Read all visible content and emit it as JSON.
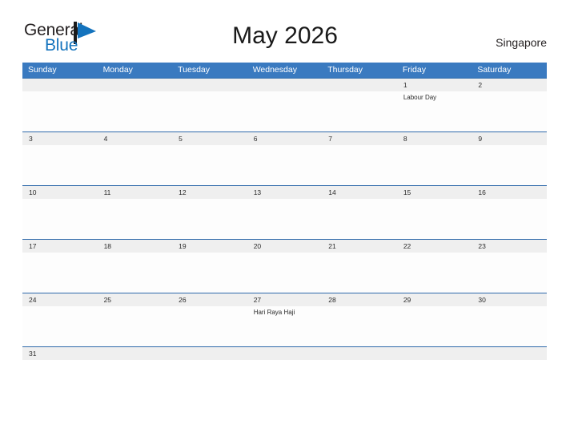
{
  "branding": {
    "logo_primary": "General",
    "logo_secondary": "Blue",
    "logo_icon": "flag-triangle-icon",
    "accent_color": "#1473bd"
  },
  "header": {
    "title": "May 2026",
    "locale": "Singapore",
    "header_bg_color": "#3a7ac0",
    "date_band_color": "#efefef",
    "row_rule_color": "#2f6aab"
  },
  "calendar": {
    "weekdays": [
      "Sunday",
      "Monday",
      "Tuesday",
      "Wednesday",
      "Thursday",
      "Friday",
      "Saturday"
    ],
    "weeks": [
      {
        "days": [
          {
            "date": "",
            "event": ""
          },
          {
            "date": "",
            "event": ""
          },
          {
            "date": "",
            "event": ""
          },
          {
            "date": "",
            "event": ""
          },
          {
            "date": "",
            "event": ""
          },
          {
            "date": "1",
            "event": "Labour Day"
          },
          {
            "date": "2",
            "event": ""
          }
        ]
      },
      {
        "days": [
          {
            "date": "3",
            "event": ""
          },
          {
            "date": "4",
            "event": ""
          },
          {
            "date": "5",
            "event": ""
          },
          {
            "date": "6",
            "event": ""
          },
          {
            "date": "7",
            "event": ""
          },
          {
            "date": "8",
            "event": ""
          },
          {
            "date": "9",
            "event": ""
          }
        ]
      },
      {
        "days": [
          {
            "date": "10",
            "event": ""
          },
          {
            "date": "11",
            "event": ""
          },
          {
            "date": "12",
            "event": ""
          },
          {
            "date": "13",
            "event": ""
          },
          {
            "date": "14",
            "event": ""
          },
          {
            "date": "15",
            "event": ""
          },
          {
            "date": "16",
            "event": ""
          }
        ]
      },
      {
        "days": [
          {
            "date": "17",
            "event": ""
          },
          {
            "date": "18",
            "event": ""
          },
          {
            "date": "19",
            "event": ""
          },
          {
            "date": "20",
            "event": ""
          },
          {
            "date": "21",
            "event": ""
          },
          {
            "date": "22",
            "event": ""
          },
          {
            "date": "23",
            "event": ""
          }
        ]
      },
      {
        "days": [
          {
            "date": "24",
            "event": ""
          },
          {
            "date": "25",
            "event": ""
          },
          {
            "date": "26",
            "event": ""
          },
          {
            "date": "27",
            "event": "Hari Raya Haji"
          },
          {
            "date": "28",
            "event": ""
          },
          {
            "date": "29",
            "event": ""
          },
          {
            "date": "30",
            "event": ""
          }
        ]
      },
      {
        "short": true,
        "days": [
          {
            "date": "31",
            "event": ""
          },
          {
            "date": "",
            "event": ""
          },
          {
            "date": "",
            "event": ""
          },
          {
            "date": "",
            "event": ""
          },
          {
            "date": "",
            "event": ""
          },
          {
            "date": "",
            "event": ""
          },
          {
            "date": "",
            "event": ""
          }
        ]
      }
    ]
  }
}
